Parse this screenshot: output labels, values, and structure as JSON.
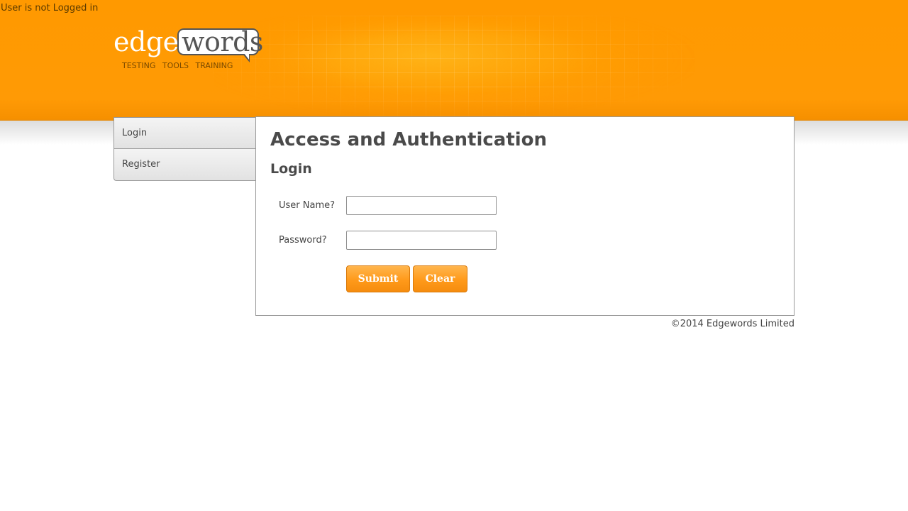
{
  "status": {
    "text": "User is not Logged in"
  },
  "logo": {
    "part1": "edge",
    "part2": "words",
    "tagline": "TESTING  TOOLS  TRAINING"
  },
  "sidebar": {
    "items": [
      {
        "label": "Login"
      },
      {
        "label": "Register"
      }
    ]
  },
  "main": {
    "title": "Access and Authentication",
    "subtitle": "Login",
    "fields": [
      {
        "label": "User Name?",
        "value": "",
        "placeholder": ""
      },
      {
        "label": "Password?",
        "value": "",
        "placeholder": ""
      }
    ],
    "buttons": {
      "submit": "Submit",
      "clear": "Clear"
    }
  },
  "footer": {
    "text": "©2014 Edgewords Limited"
  },
  "colors": {
    "header": "#ff9900",
    "button": "#ff9a1a",
    "text": "#444444"
  }
}
